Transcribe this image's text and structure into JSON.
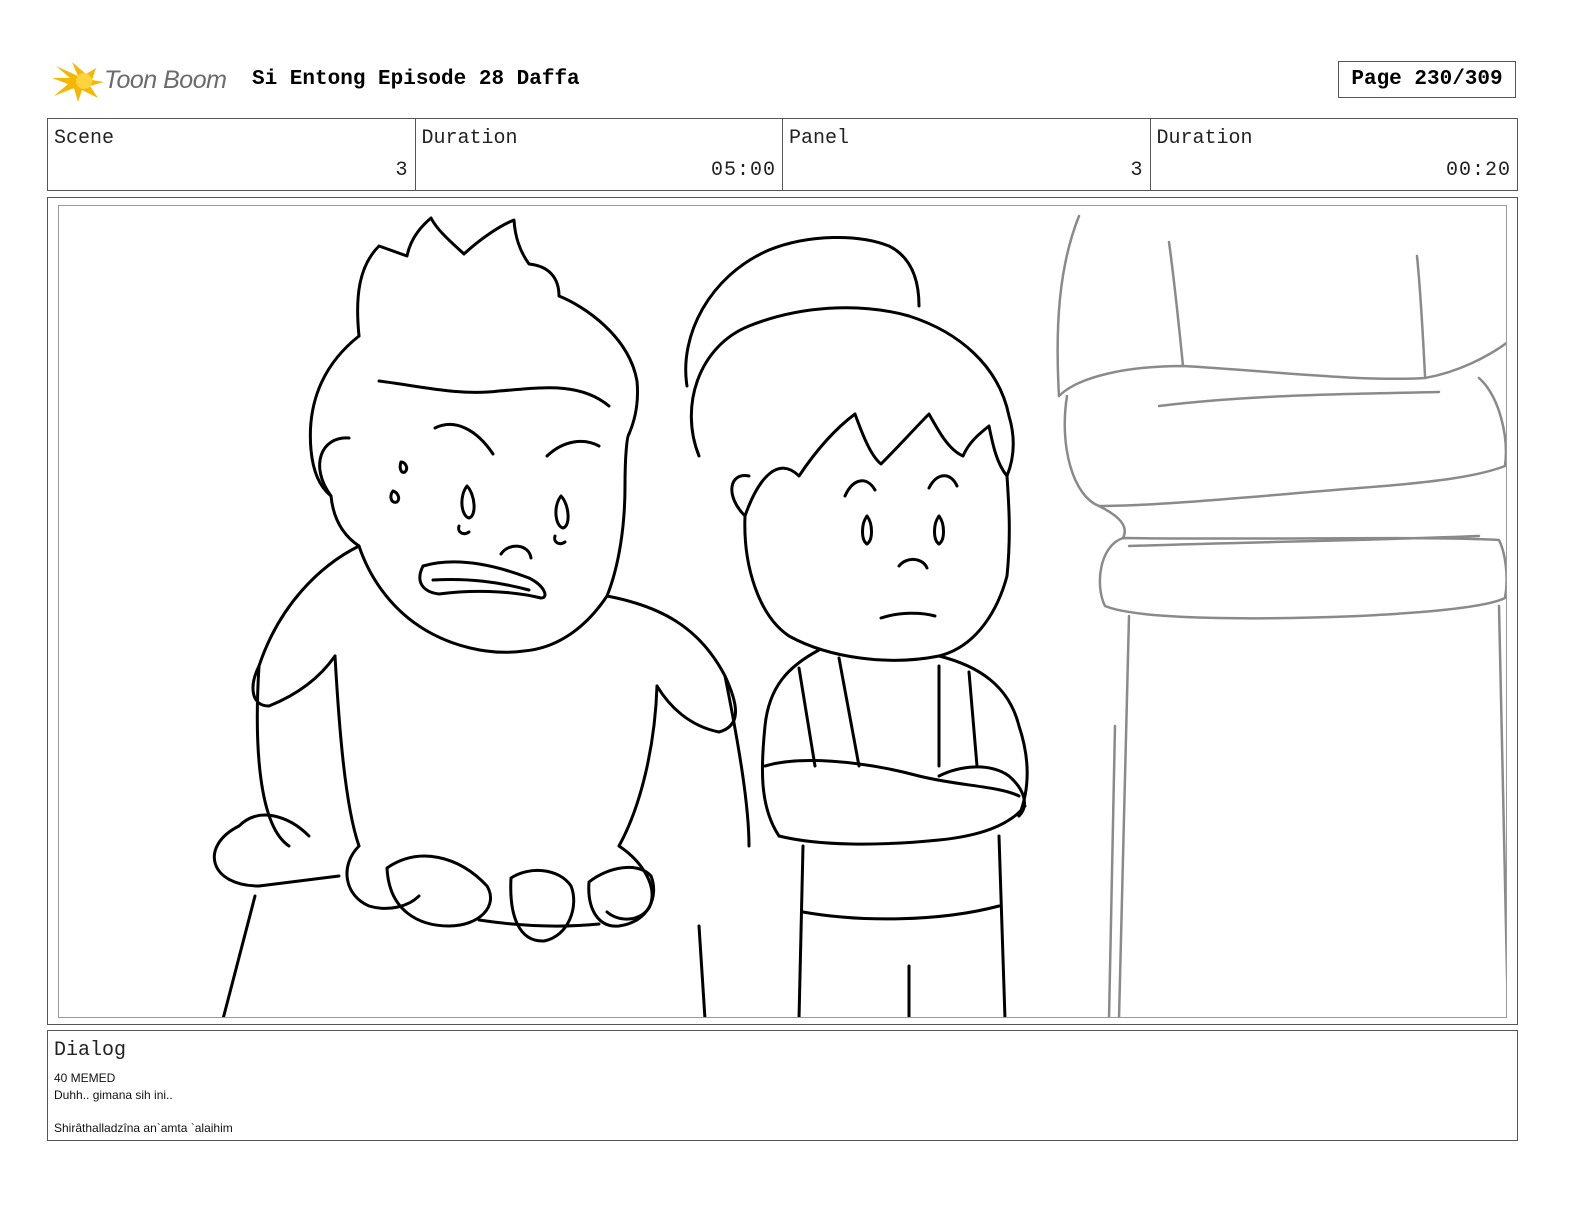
{
  "header": {
    "logo_text": "Toon Boom",
    "title": "Si Entong Episode 28 Daffa",
    "page": "Page 230/309"
  },
  "info": {
    "scene_label": "Scene",
    "scene_value": "3",
    "scene_duration_label": "Duration",
    "scene_duration_value": "05:00",
    "panel_label": "Panel",
    "panel_value": "3",
    "panel_duration_label": "Duration",
    "panel_duration_value": "00:20"
  },
  "dialog": {
    "label": "Dialog",
    "character": "40 MEMED",
    "line1": "Duhh.. gimana sih ini..",
    "line2": "Shirâthalladzîna an`amta `alaihim"
  },
  "colors": {
    "logo_accent": "#F5B800",
    "border": "#555555",
    "sketch_line": "#000000",
    "sketch_grey": "#8a8a8a"
  }
}
